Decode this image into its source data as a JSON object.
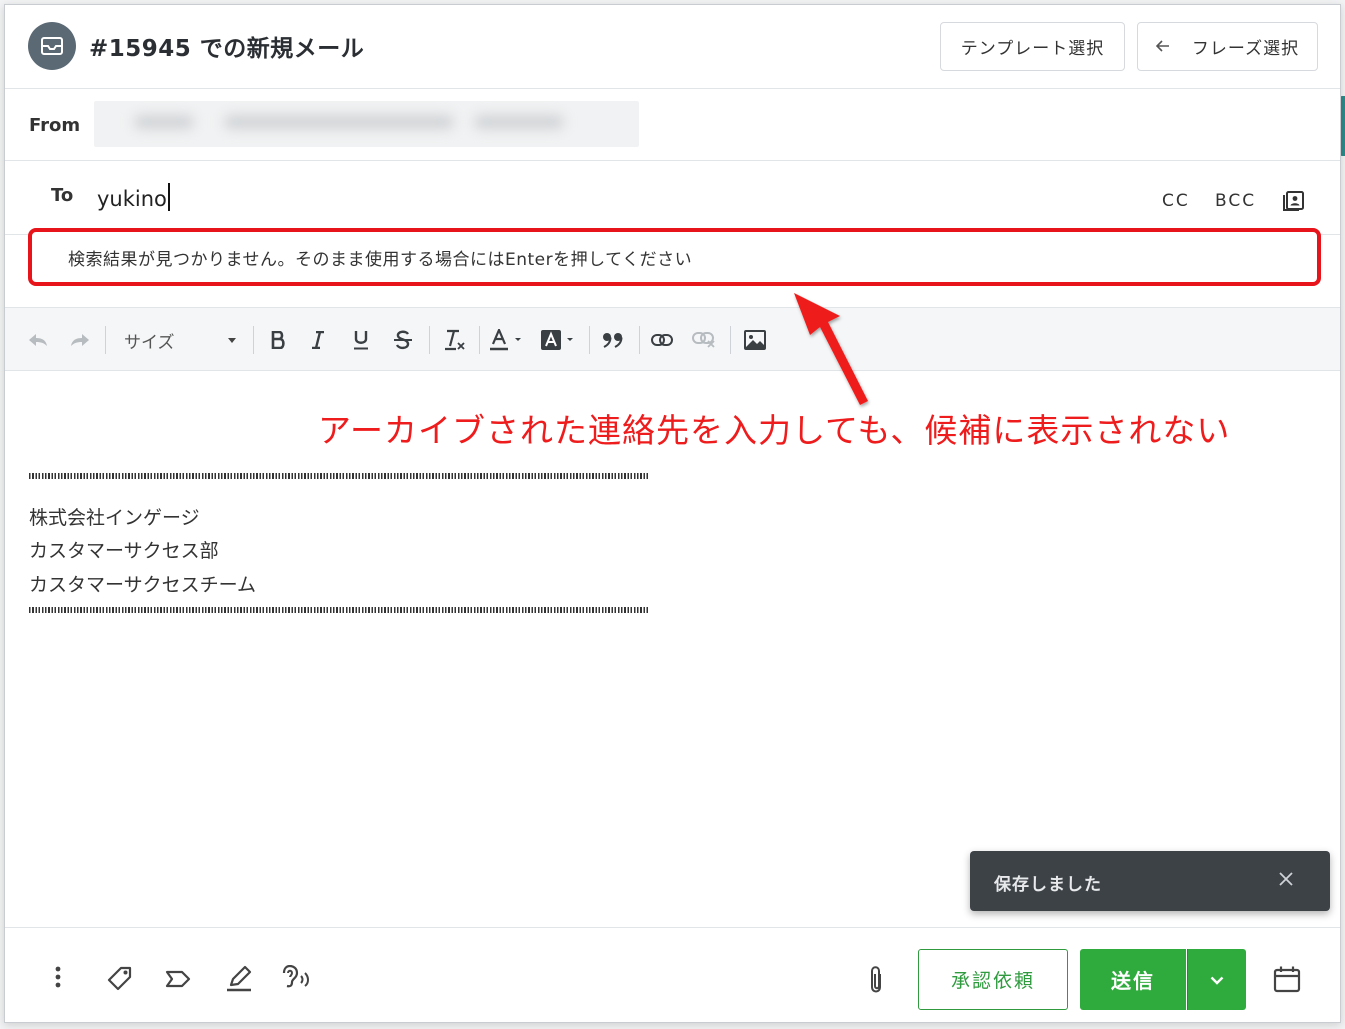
{
  "header": {
    "title": "#15945 での新規メール",
    "template_button": "テンプレート選択",
    "phrase_button": "フレーズ選択"
  },
  "from": {
    "label": "From"
  },
  "to": {
    "label": "To",
    "value": "yukino",
    "cc_label": "CC",
    "bcc_label": "BCC"
  },
  "suggestion": {
    "message": "検索結果が見つかりません。そのまま使用する場合にはEnterを押してください"
  },
  "toolbar": {
    "size_label": "サイズ"
  },
  "signature": {
    "lines": [
      "株式会社インゲージ",
      "カスタマーサクセス部",
      "カスタマーサクセスチーム"
    ]
  },
  "annotation": {
    "text": "アーカイブされた連絡先を入力しても、候補に表示されない"
  },
  "toast": {
    "message": "保存しました"
  },
  "footer": {
    "approve_label": "承認依頼",
    "send_label": "送信"
  },
  "colors": {
    "accent_green": "#2faa3c",
    "annotation_red": "#e8141b",
    "toast_bg": "#3d4247"
  },
  "icons": [
    "mail-icon",
    "arrow-left-icon",
    "contacts-icon",
    "undo-icon",
    "redo-icon",
    "bold-icon",
    "italic-icon",
    "underline-icon",
    "strikethrough-icon",
    "clear-format-icon",
    "text-color-icon",
    "background-color-icon",
    "quote-icon",
    "link-icon",
    "unlink-icon",
    "image-icon",
    "more-vertical-icon",
    "tag-icon",
    "label-icon",
    "pen-icon",
    "hearing-icon",
    "paperclip-icon",
    "chevron-down-icon",
    "calendar-icon",
    "close-icon"
  ]
}
